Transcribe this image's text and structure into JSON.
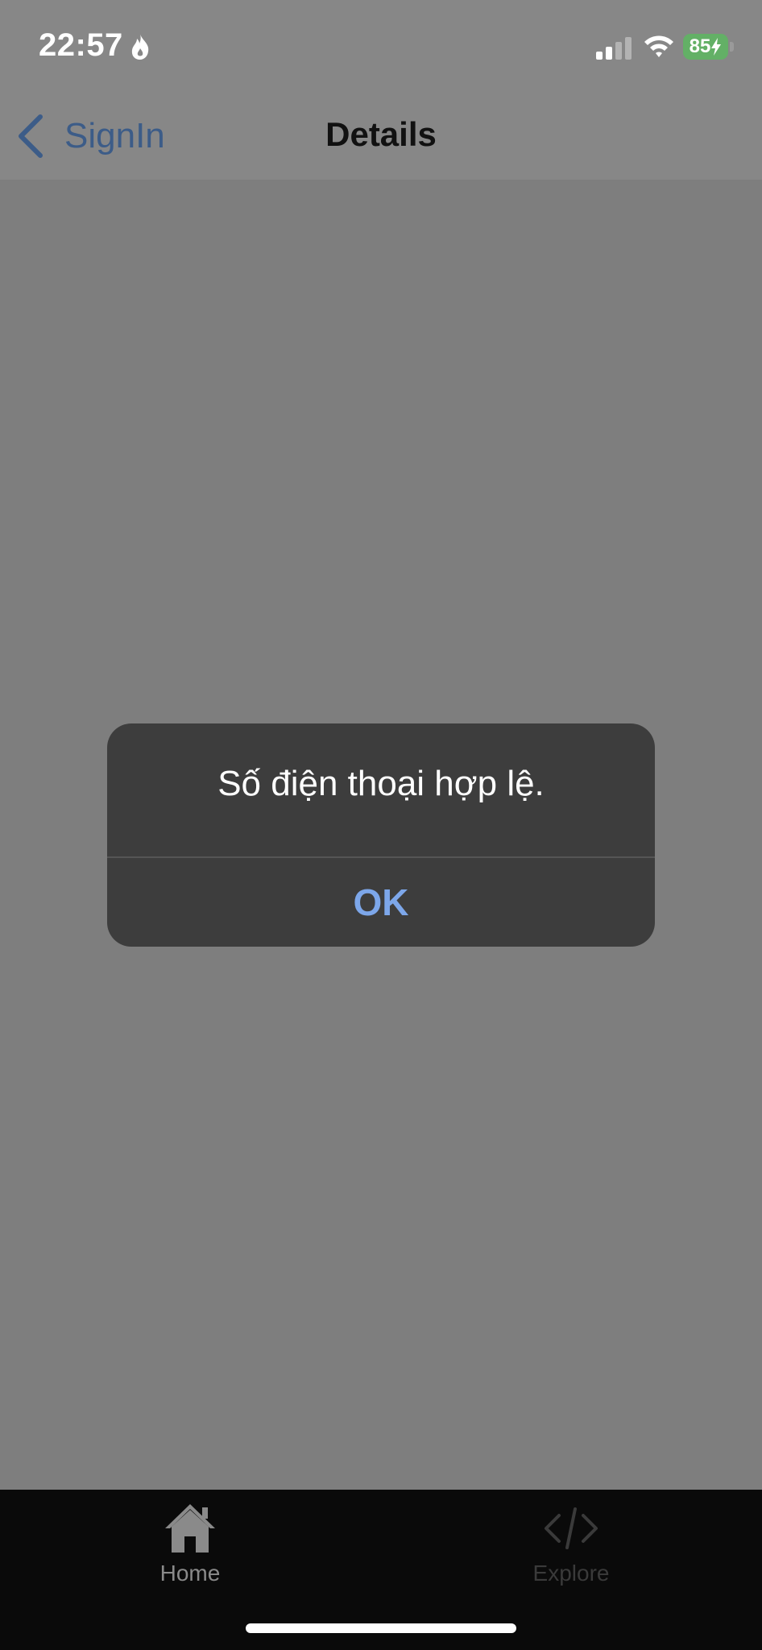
{
  "status_bar": {
    "time": "22:57",
    "battery_level": "85",
    "battery_color": "#63b066",
    "icons": [
      "flame-icon",
      "signal-icon",
      "wifi-icon",
      "battery-icon"
    ]
  },
  "nav": {
    "back_label": "SignIn",
    "title": "Details",
    "back_icon": "chevron-left-icon",
    "accent_color": "#3c5c88"
  },
  "alert": {
    "message": "Số điện thoại hợp lệ.",
    "ok_label": "OK",
    "ok_color": "#7da7ea"
  },
  "tab_bar": {
    "items": [
      {
        "label": "Home",
        "icon": "house-icon",
        "selected": true
      },
      {
        "label": "Explore",
        "icon": "code-icon",
        "selected": false
      }
    ]
  }
}
